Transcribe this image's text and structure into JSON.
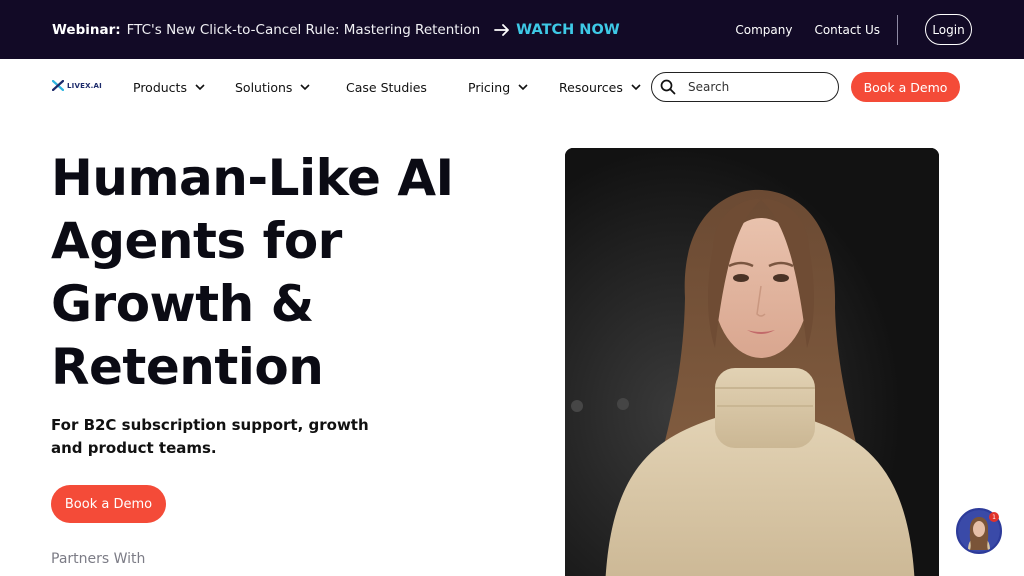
{
  "banner": {
    "label": "Webinar:",
    "title": "FTC's New Click-to-Cancel Rule: Mastering Retention",
    "watch_label": "WATCH NOW",
    "links": [
      "Company",
      "Contact Us"
    ],
    "login_label": "Login"
  },
  "nav": {
    "logo_text": "LIVEX.AI",
    "items": [
      {
        "label": "Products",
        "dropdown": true
      },
      {
        "label": "Solutions",
        "dropdown": true
      },
      {
        "label": "Case Studies",
        "dropdown": false
      },
      {
        "label": "Pricing",
        "dropdown": true
      },
      {
        "label": "Resources",
        "dropdown": true
      }
    ],
    "search_placeholder": "Search",
    "demo_label": "Book a Demo"
  },
  "hero": {
    "title_lines": [
      "Human-Like AI",
      "Agents for",
      "Growth &",
      "Retention"
    ],
    "subtitle": "For B2C subscription support, growth and product teams.",
    "cta_label": "Book a Demo",
    "partners_label": "Partners With"
  },
  "chat_widget": {
    "badge": "1"
  },
  "colors": {
    "banner_bg": "#120a26",
    "accent_cyan": "#3ec9e6",
    "cta_red": "#f44b38",
    "logo_blue": "#1c2b6b"
  }
}
